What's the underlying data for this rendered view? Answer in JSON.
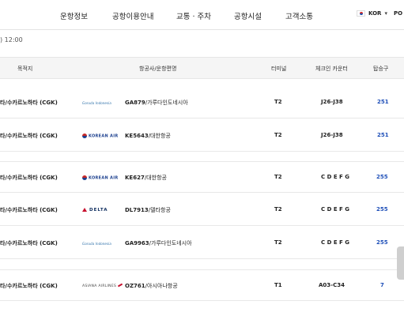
{
  "nav": {
    "items": [
      "운항정보",
      "공항이용안내",
      "교통 · 주차",
      "공항시설",
      "고객소통"
    ],
    "lang_code": "KOR",
    "lang_next": "PO"
  },
  "timestamp": "⁠) 12:00",
  "table": {
    "headers": {
      "destination": "목적지",
      "airline_flight": "항공사/운항편명",
      "terminal": "터미널",
      "checkin": "체크인 카운터",
      "gate": "탑승구"
    },
    "rows": [
      {
        "destination": "타/수카르노하타 (CGK)",
        "logo": "Garuda Indonesia",
        "logo_type": "garuda",
        "flight": "GA879",
        "airline": "/가루다인도네시아",
        "terminal": "T2",
        "checkin": "J26-J38",
        "gate": "251"
      },
      {
        "destination": "타/수카르노하타 (CGK)",
        "logo": "KOREAN AIR",
        "logo_type": "korean",
        "flight": "KE5643",
        "airline": "/대한항공",
        "terminal": "T2",
        "checkin": "J26-J38",
        "gate": "251"
      },
      {
        "destination": "타/수카르노하타 (CGK)",
        "logo": "KOREAN AIR",
        "logo_type": "korean",
        "flight": "KE627",
        "airline": "/대한항공",
        "terminal": "T2",
        "checkin": "C D E F G",
        "gate": "255"
      },
      {
        "destination": "타/수카르노하타 (CGK)",
        "logo": "DELTA",
        "logo_type": "delta",
        "flight": "DL7913",
        "airline": "/델타항공",
        "terminal": "T2",
        "checkin": "C D E F G",
        "gate": "255"
      },
      {
        "destination": "타/수카르노하타 (CGK)",
        "logo": "Garuda Indonesia",
        "logo_type": "garuda",
        "flight": "GA9963",
        "airline": "/가루다인도네시아",
        "terminal": "T2",
        "checkin": "C D E F G",
        "gate": "255"
      },
      {
        "destination": "타/수카르노하타 (CGK)",
        "logo": "ASIANA AIRLINES",
        "logo_type": "asiana",
        "flight": "OZ761",
        "airline": "/아시아나항공",
        "terminal": "T1",
        "checkin": "A03-C34",
        "gate": "7"
      }
    ]
  },
  "colors": {
    "gate": "#1e4fb8",
    "header_bg": "#f5f5f5"
  }
}
